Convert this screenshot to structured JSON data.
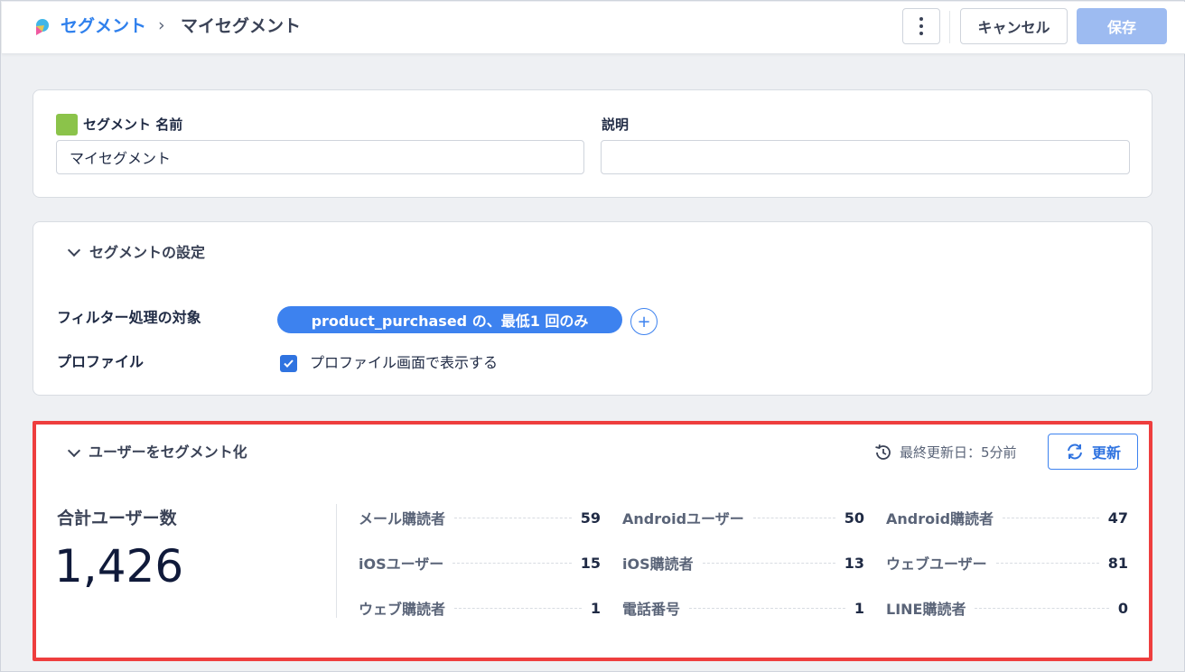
{
  "header": {
    "breadcrumb_root": "セグメント",
    "breadcrumb_separator": "›",
    "breadcrumb_current": "マイセグメント",
    "cancel_label": "キャンセル",
    "save_label": "保存"
  },
  "name_card": {
    "name_label": "セグメント 名前",
    "name_value": "マイセグメント",
    "description_label": "説明",
    "description_value": "",
    "swatch_color": "#8bc34a"
  },
  "settings": {
    "title": "セグメントの設定",
    "filter_label": "フィルター処理の対象",
    "filter_pill": "product_purchased の、最低1 回のみ",
    "profile_label": "プロファイル",
    "profile_checkbox_label": "プロファイル画面で表示する",
    "profile_checked": true
  },
  "segment_users": {
    "title": "ユーザーをセグメント化",
    "last_updated": "最終更新日：5分前",
    "refresh_label": "更新",
    "total_label": "合計ユーザー数",
    "total_value": "1,426",
    "stats": [
      {
        "label": "メール購読者",
        "value": "59"
      },
      {
        "label": "Androidユーザー",
        "value": "50"
      },
      {
        "label": "Android購読者",
        "value": "47"
      },
      {
        "label": "iOSユーザー",
        "value": "15"
      },
      {
        "label": "iOS購読者",
        "value": "13"
      },
      {
        "label": "ウェブユーザー",
        "value": "81"
      },
      {
        "label": "ウェブ購読者",
        "value": "1"
      },
      {
        "label": "電話番号",
        "value": "1"
      },
      {
        "label": "LINE購読者",
        "value": "0"
      }
    ]
  },
  "colors": {
    "accent": "#2f80ed",
    "highlight_border": "#ee3e3e"
  }
}
